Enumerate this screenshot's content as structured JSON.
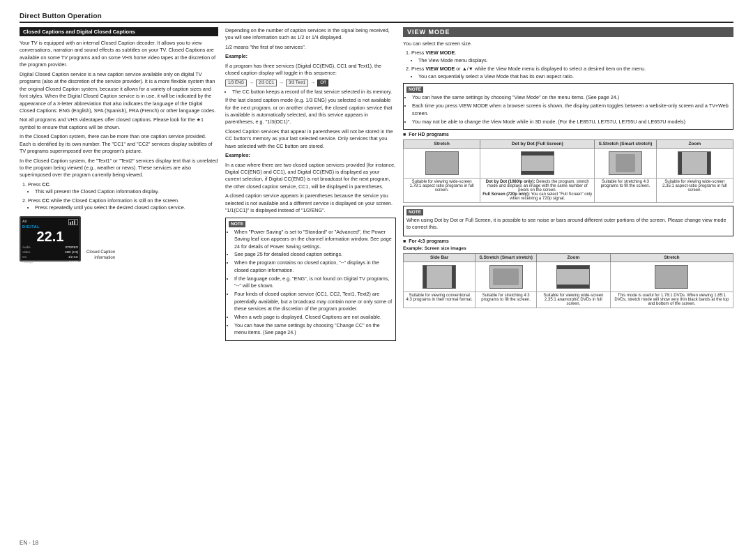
{
  "page": {
    "section_title": "Direct Button Operation",
    "page_number": "18",
    "page_prefix": "EN -"
  },
  "left_col": {
    "cc_header": "Closed Captions and Digital Closed Captions",
    "paragraphs": [
      "Your TV is equipped with an internal Closed Caption decoder. It allows you to view conversations, narration and sound effects as subtitles on your TV. Closed Captions are available on some TV programs and on some VHS home video tapes at the discretion of the program provider.",
      "Digital Closed Caption service is a new caption service available only on digital TV programs (also at the discretion of the service provider). It is a more flexible system than the original Closed Caption system, because it allows for a variety of caption sizes and font styles. When the Digital Closed Caption service is in use, it will be indicated by the appearance of a 3-letter abbreviation that also indicates the language of the Digital Closed Captions: ENG (English), SPA (Spanish), FRA (French) or other language codes.",
      "Not all programs and VHS videotapes offer closed captions. Please look for the ★1 symbol to ensure that captions will be shown.",
      "In the Closed Caption system, there can be more than one caption service provided. Each is identified by its own number. The \"CC1\" and \"CC2\" services display subtitles of TV programs superimposed over the program's picture.",
      "In the Closed Caption system, the \"Text1\" or \"Text2\" services display text that is unrelated to the program being viewed (e.g., weather or news). These services are also superimposed over the program currently being viewed."
    ],
    "steps": [
      {
        "num": "1",
        "text": "Press CC.",
        "sub": [
          "This will present the Closed Caption information display."
        ]
      },
      {
        "num": "2",
        "text": "Press CC while the Closed Caption information is still on the screen.",
        "sub": [
          "Press repeatedly until you select the desired closed caption service."
        ]
      }
    ],
    "tv_labels": {
      "air": "Air",
      "digital": "DIGITAL",
      "channel": "22.1",
      "audio": "Audio",
      "audio_val": "STEREO",
      "video": "Video",
      "video_val": "480i (4:3)",
      "cc": "CC",
      "cc_val": "1/2 CC",
      "ratings": "Ratings",
      "ratings_val": "NONE"
    },
    "caption_info_label": "Closed Caption\ninformation"
  },
  "mid_col": {
    "paragraphs_top": [
      "Depending on the number of caption services in the signal being received, you will see information such as 1/2 or 1/4 displayed.",
      "1/2 means \"the first of two services\"."
    ],
    "example_label": "Example:",
    "example_text": "If a program has three services (Digital CC(ENG), CC1 and Text1), the closed caption display will toggle in this sequence:",
    "sequence": [
      "1/3 ENG",
      "2/3 CC1",
      "3/3 Text1",
      "Off"
    ],
    "sequence_dark": [
      false,
      false,
      false,
      true
    ],
    "cc_note": "The CC button keeps a record of the last service selected in its memory.",
    "last_service_text": "If the last closed caption mode (e.g. 1/3 ENG) you selected is not available for the next program, or on another channel, the closed caption service that is available is automatically selected, and this service appears in parentheses, e.g. \"1/3(OC1)\".",
    "not_stored_text": "Closed Caption services that appear in parentheses will not be stored in the CC button's memory as your last selected service. Only services that you have selected with the CC button are stored.",
    "examples_label": "Examples:",
    "examples_text": "In a case where there are two closed caption services provided (for instance, Digital CC(ENG) and CC1), and Digital CC(ENG) is displayed as your current selection, if Digital CC(ENG) is not broadcast for the next program, the other closed caption service, CC1, will be displayed in parentheses.",
    "examples_text2": "A closed caption service appears in parentheses because the service you selected is not available and a different service is displayed on your screen. \"1/1(CC1)\" is displayed instead of \"1/2/ENG\".",
    "note_items": [
      "When \"Power Saving\" is set to \"Standard\" or \"Advanced\", the Power Saving leaf icon appears on the channel information window. See page 24 for details of Power Saving settings.",
      "See page 25 for detailed closed caption settings.",
      "When the program contains no closed caption, \"--\" displays in the closed caption information.",
      "If the language code, e.g. \"ENG\", is not found on Digital TV programs, \"--\" will be shown.",
      "Four kinds of closed caption service (CC1, CC2, Text1, Text2) are potentially available, but a broadcast may contain none or only some of these services at the discretion of the program provider.",
      "When a web page is displayed, Closed Captions are not available.",
      "You can have the same settings by choosing \"Change CC\" on the menu items. (See page 24.)"
    ]
  },
  "right_col": {
    "view_mode_header": "VIEW MODE",
    "intro": "You can select the screen size.",
    "steps": [
      {
        "num": "1",
        "text": "Press VIEW MODE.",
        "sub": [
          "The View Mode menu displays."
        ]
      },
      {
        "num": "2",
        "text": "Press VIEW MODE or ▲/▼ while the View Mode menu is displayed to select a desired item on the menu.",
        "sub": [
          "You can sequentially select a View Mode that has its own aspect ratio."
        ]
      }
    ],
    "note_items": [
      "You can have the same settings by choosing \"View Mode\" on the menu items. (See page 24.)",
      "Each time you press VIEW MODE when a browser screen is shown, the display pattern toggles between a website-only screen and a TV+Web screen.",
      "You may not be able to change the View Mode while in 3D mode. (For the LE857U, LE757U, LE755U and LE657U models)"
    ],
    "hd_section": "For HD programs",
    "hd_table": {
      "headers": [
        "Stretch",
        "Dot by Dot (Full Screen)",
        "S.Stretch (Smart stretch)",
        "Zoom"
      ],
      "descriptions": [
        "Suitable for viewing wide-screen 1.78:1 aspect ratio programs in full screen.",
        "Dot by Dot (1080/p only): Detects the program, stretch mode and displays an image with the same number of pixels on the screen.\nFull Screen (720p only): You can select \"Full Screen\" only when receiving a 720p signal.",
        "Suitable for stretching 4:3 programs to fill the screen.",
        "Suitable for viewing wide-screen 2.35:1 aspect-ratio programs in full screen."
      ]
    },
    "hd_note": "When using Dot by Dot or Full Screen, it is possible to see noise or bars around different outer portions of the screen. Please change view mode to correct this.",
    "sd_section": "For 4:3 programs",
    "sd_example": "Example: Screen size images",
    "sd_table": {
      "headers": [
        "Side Bar",
        "S.Stretch (Smart stretch)",
        "Zoom",
        "Stretch"
      ],
      "descriptions": [
        "Suitable for viewing conventional 4:3 programs in their normal format.",
        "Suitable for stretching 4:3 programs to fill the screen.",
        "Suitable for viewing wide-screen 2.35:1 anamorphic DVDs in full screen.",
        "This mode is useful for 1.78:1 DVDs. When viewing 1.85:1 DVDs, stretch mode will show very thin black bands at the top and bottom of the screen."
      ]
    }
  }
}
